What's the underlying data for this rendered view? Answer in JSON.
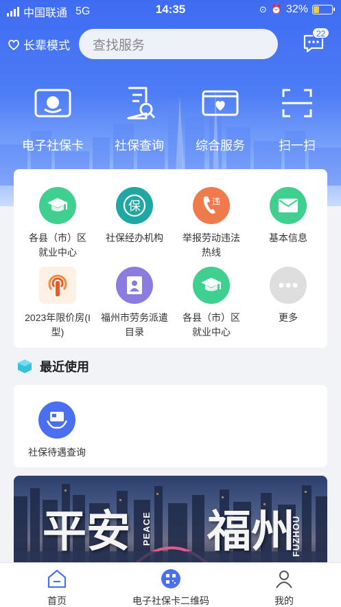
{
  "status": {
    "carrier": "中国联通",
    "network": "5G",
    "time": "14:35",
    "battery": "32%",
    "battery_level": 0.32
  },
  "header": {
    "elder_mode": "长辈模式",
    "search_placeholder": "查找服务",
    "message_badge": "22",
    "actions": [
      {
        "label": "电子社保卡",
        "icon": "social-card-icon"
      },
      {
        "label": "社保查询",
        "icon": "document-search-icon"
      },
      {
        "label": "综合服务",
        "icon": "heart-card-icon"
      },
      {
        "label": "扫一扫",
        "icon": "scan-icon"
      }
    ]
  },
  "services": [
    {
      "label": "各县（市）区就业中心",
      "icon": "graduation-cap-icon",
      "color": "#3fcf8e"
    },
    {
      "label": "社保经办机构",
      "icon": "bao-seal-icon",
      "color": "#1fa7a3"
    },
    {
      "label": "举报劳动违法热线",
      "icon": "phone-report-icon",
      "color": "#f07a4c"
    },
    {
      "label": "基本信息",
      "icon": "mail-icon",
      "color": "#3fcf8e"
    },
    {
      "label": "2023年限价房(I型)",
      "icon": "broadcast-icon",
      "color": "#f08a3a"
    },
    {
      "label": "福州市劳务派遣目录",
      "icon": "person-card-icon",
      "color": "#8c7ce0"
    },
    {
      "label": "各县（市）区就业中心",
      "icon": "graduation-cap-icon",
      "color": "#3fcf8e"
    },
    {
      "label": "更多",
      "icon": "more-icon",
      "color": "#d9d9d9"
    }
  ],
  "recent": {
    "title": "最近使用",
    "items": [
      {
        "label": "社保待遇查询",
        "icon": "card-hand-icon",
        "color": "#4a6ff0"
      }
    ]
  },
  "banner": {
    "text1": "平安",
    "text2": "福州",
    "en1": "PEACE",
    "en2": "FUZHOU"
  },
  "tabs": [
    {
      "label": "首页",
      "icon": "home-icon"
    },
    {
      "label": "电子社保卡二维码",
      "icon": "qr-code-icon"
    },
    {
      "label": "我的",
      "icon": "user-icon"
    }
  ]
}
